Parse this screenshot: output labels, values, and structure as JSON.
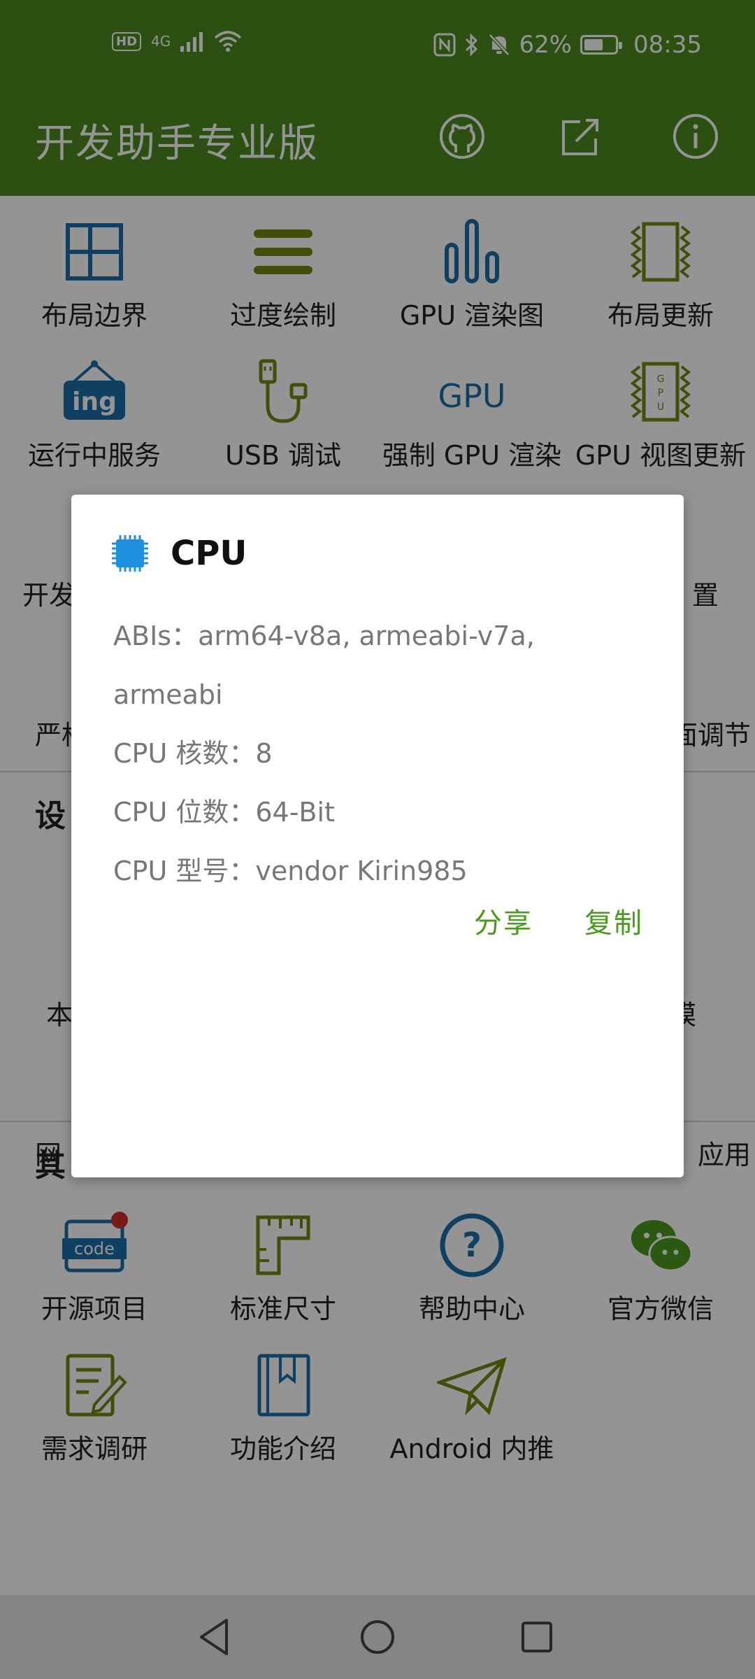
{
  "status_bar": {
    "hd": "HD",
    "network": "4G",
    "battery": "62%",
    "battery_level": 0.62,
    "time": "08:35"
  },
  "toolbar": {
    "title": "开发助手专业版",
    "icons": [
      "github-icon",
      "share-icon",
      "info-icon"
    ]
  },
  "colors": {
    "accent": "#4a8a1e",
    "icon_blue": "#1a6fa8",
    "icon_olive": "#6e8a12",
    "chip_blue": "#1e90e0"
  },
  "section1": {
    "row1": [
      {
        "label": "布局边界",
        "icon": "layout-bounds-icon"
      },
      {
        "label": "过度绘制",
        "icon": "overdraw-icon"
      },
      {
        "label": "GPU 渲染图",
        "icon": "gpu-render-chart-icon"
      },
      {
        "label": "布局更新",
        "icon": "layout-update-icon"
      }
    ],
    "row2": [
      {
        "label": "运行中服务",
        "icon": "running-services-icon"
      },
      {
        "label": "USB 调试",
        "icon": "usb-debug-icon"
      },
      {
        "label": "强制 GPU 渲染",
        "icon": "force-gpu-icon"
      },
      {
        "label": "GPU 视图更新",
        "icon": "gpu-view-update-icon"
      }
    ],
    "row3": [
      {
        "label": "开发",
        "icon": "developer-icon"
      },
      {
        "label": "置",
        "icon": "settings-icon"
      }
    ],
    "row4": [
      {
        "label": "严格",
        "icon": "strict-mode-icon"
      },
      {
        "label": "面调节",
        "icon": "adjust-icon"
      }
    ]
  },
  "section2": {
    "title": "设",
    "row1": [
      {
        "label": "本",
        "icon": "device-icon"
      },
      {
        "label": "模",
        "icon": "mode-icon"
      }
    ],
    "row2": [
      {
        "label": "网",
        "icon": "network-icon"
      },
      {
        "label": "应用",
        "icon": "apps-icon"
      }
    ]
  },
  "section3": {
    "title": "其",
    "row1": [
      {
        "label": "开源项目",
        "icon": "open-source-code-icon"
      },
      {
        "label": "标准尺寸",
        "icon": "ruler-icon"
      },
      {
        "label": "帮助中心",
        "icon": "help-icon"
      },
      {
        "label": "官方微信",
        "icon": "wechat-icon"
      }
    ],
    "row2": [
      {
        "label": "需求调研",
        "icon": "survey-icon"
      },
      {
        "label": "功能介绍",
        "icon": "book-icon"
      },
      {
        "label": "Android 内推",
        "icon": "send-icon"
      }
    ]
  },
  "dialog": {
    "icon": "cpu-chip-icon",
    "title": "CPU",
    "lines": [
      "ABIs：arm64-v8a, armeabi-v7a,",
      "armeabi",
      "CPU 核数：8",
      "CPU 位数：64-Bit",
      "CPU 型号：vendor Kirin985"
    ],
    "share_label": "分享",
    "copy_label": "复制"
  },
  "navbar": {
    "icons": [
      "back-icon",
      "home-icon",
      "recents-icon"
    ]
  }
}
